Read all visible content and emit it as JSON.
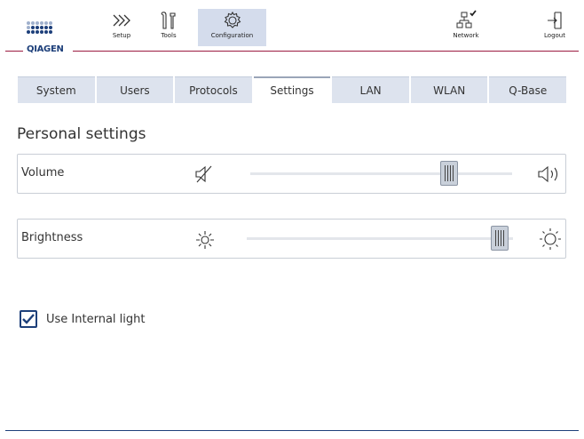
{
  "header": {
    "logo_text": "QIAGEN",
    "nav": [
      {
        "label": "Setup",
        "icon": "chevrons-right-icon"
      },
      {
        "label": "Tools",
        "icon": "tools-icon"
      },
      {
        "label": "Configuration",
        "icon": "gear-icon",
        "active": true
      },
      {
        "label": "Network",
        "icon": "network-icon"
      },
      {
        "label": "Logout",
        "icon": "logout-icon"
      }
    ]
  },
  "tabs": [
    {
      "label": "System"
    },
    {
      "label": "Users"
    },
    {
      "label": "Protocols"
    },
    {
      "label": "Settings",
      "active": true
    },
    {
      "label": "LAN"
    },
    {
      "label": "WLAN"
    },
    {
      "label": "Q-Base"
    }
  ],
  "section": {
    "title": "Personal settings"
  },
  "volume": {
    "label": "Volume",
    "level": 0.76,
    "min_icon": "volume-mute-icon",
    "max_icon": "volume-high-icon"
  },
  "brightness": {
    "label": "Brightness",
    "level": 0.95,
    "min_icon": "brightness-low-icon",
    "max_icon": "brightness-high-icon"
  },
  "internal_light": {
    "label": "Use Internal light",
    "checked": true
  },
  "colors": {
    "accent": "#9b1b40",
    "brand": "#1d3f7a",
    "tab_bg": "#dde3ee",
    "active_nav": "#d4dcec"
  }
}
